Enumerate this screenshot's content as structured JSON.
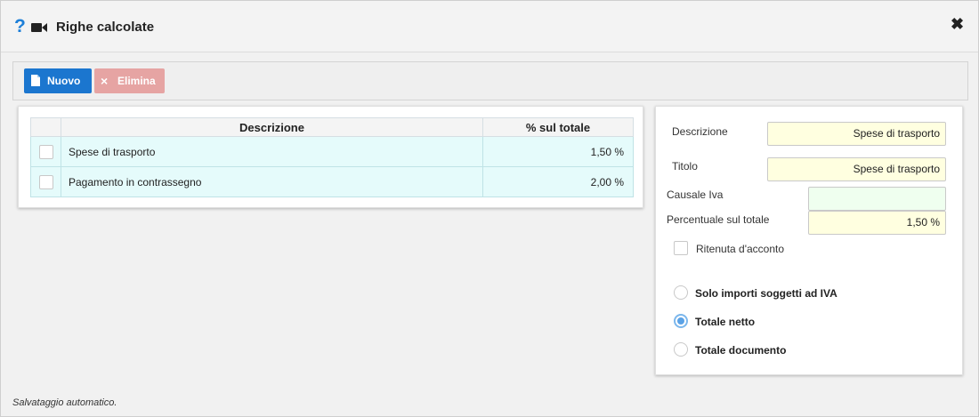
{
  "window": {
    "title": "Righe calcolate",
    "status_text": "Salvataggio automatico."
  },
  "toolbar": {
    "new_label": "Nuovo",
    "delete_label": "Elimina"
  },
  "table": {
    "columns": [
      "Descrizione",
      "% sul totale"
    ],
    "rows": [
      {
        "description": "Spese di trasporto",
        "percent": "1,50 %"
      },
      {
        "description": "Pagamento in contrassegno",
        "percent": "2,00 %"
      }
    ]
  },
  "form": {
    "descrizione_label": "Descrizione",
    "descrizione_value": "Spese di trasporto",
    "titolo_label": "Titolo",
    "titolo_value": "Spese di trasporto",
    "causale_label": "Causale Iva",
    "causale_value": "",
    "percentuale_label": "Percentuale sul totale",
    "percentuale_value": "1,50 %",
    "ritenuta_label": "Ritenuta d'acconto",
    "ritenuta_checked": false,
    "options": [
      {
        "label": "Solo importi soggetti ad IVA",
        "selected": false
      },
      {
        "label": "Totale netto",
        "selected": true
      },
      {
        "label": "Totale documento",
        "selected": false
      }
    ]
  },
  "colors": {
    "primary_button": "#1b76cf",
    "danger_button_disabled": "#e6a4a3",
    "help_icon": "#1d7fd8",
    "row_background": "#e5fbfb",
    "input_yellow": "#ffffe0",
    "input_green": "#efffef"
  },
  "icons": [
    "help-icon",
    "video-icon",
    "close-icon",
    "document-icon",
    "x-icon"
  ]
}
